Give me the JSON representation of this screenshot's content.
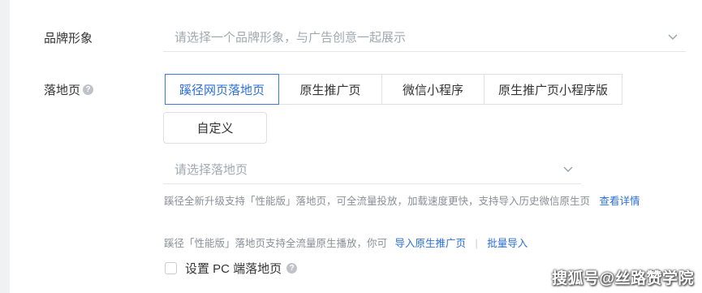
{
  "brand": {
    "label": "品牌形象",
    "placeholder": "请选择一个品牌形象，与广告创意一起展示"
  },
  "landing": {
    "label": "落地页",
    "help_icon": "question-circle-icon",
    "tabs": [
      {
        "label": "蹊径网页落地页",
        "active": true
      },
      {
        "label": "原生推广页",
        "active": false
      },
      {
        "label": "微信小程序",
        "active": false
      },
      {
        "label": "原生推广页小程序版",
        "active": false
      }
    ],
    "custom_label": "自定义",
    "select_placeholder": "请选择落地页",
    "hint1": {
      "text": "蹊径全新升级支持「性能版」落地页，可全流量投放，加载速度更快，支持导入历史微信原生页",
      "link": "查看详情"
    },
    "hint2": {
      "text": "蹊径「性能版」落地页支持全流量原生播放，你可",
      "link1": "导入原生推广页",
      "separator": "|",
      "link2": "批量导入"
    },
    "pc_checkbox": {
      "label": "设置 PC 端落地页",
      "checked": false
    }
  },
  "watermark": "搜狐号@丝路赞学院",
  "colors": {
    "accent": "#2a6fd6",
    "border": "#dcdfe4",
    "hint": "#8a8f97"
  }
}
